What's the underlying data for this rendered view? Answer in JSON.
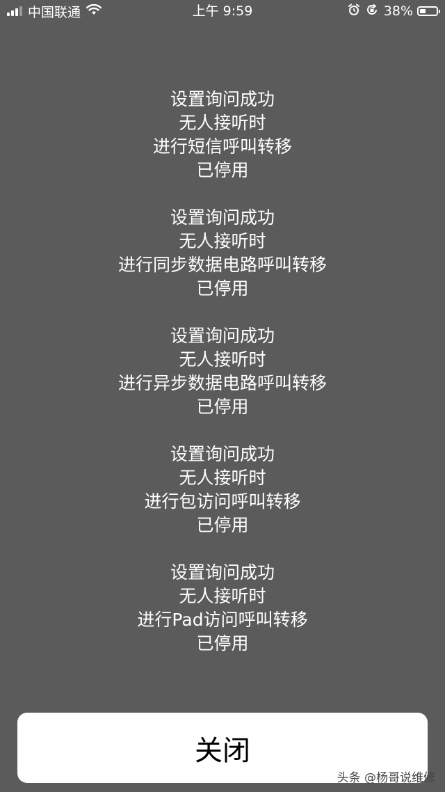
{
  "status_bar": {
    "carrier": "中国联通",
    "time": "上午 9:59",
    "battery_percent": "38%",
    "battery_level": 0.38,
    "icons": [
      "signal-icon",
      "wifi-icon",
      "alarm-icon",
      "rotation-lock-icon",
      "battery-icon"
    ]
  },
  "messages": [
    {
      "lines": [
        "设置询问成功",
        "无人接听时",
        "进行短信呼叫转移",
        "已停用"
      ]
    },
    {
      "lines": [
        "设置询问成功",
        "无人接听时",
        "进行同步数据电路呼叫转移",
        "已停用"
      ]
    },
    {
      "lines": [
        "设置询问成功",
        "无人接听时",
        "进行异步数据电路呼叫转移",
        "已停用"
      ]
    },
    {
      "lines": [
        "设置询问成功",
        "无人接听时",
        "进行包访问呼叫转移",
        "已停用"
      ]
    },
    {
      "lines": [
        "设置询问成功",
        "无人接听时",
        "进行Pad访问呼叫转移",
        "已停用"
      ]
    }
  ],
  "close_button": {
    "label": "关闭"
  },
  "watermark": {
    "text": "头条 @杨哥说维修"
  },
  "colors": {
    "background": "#5b5b5b",
    "text": "#ffffff",
    "button_bg": "#ffffff",
    "button_text": "#000000"
  }
}
